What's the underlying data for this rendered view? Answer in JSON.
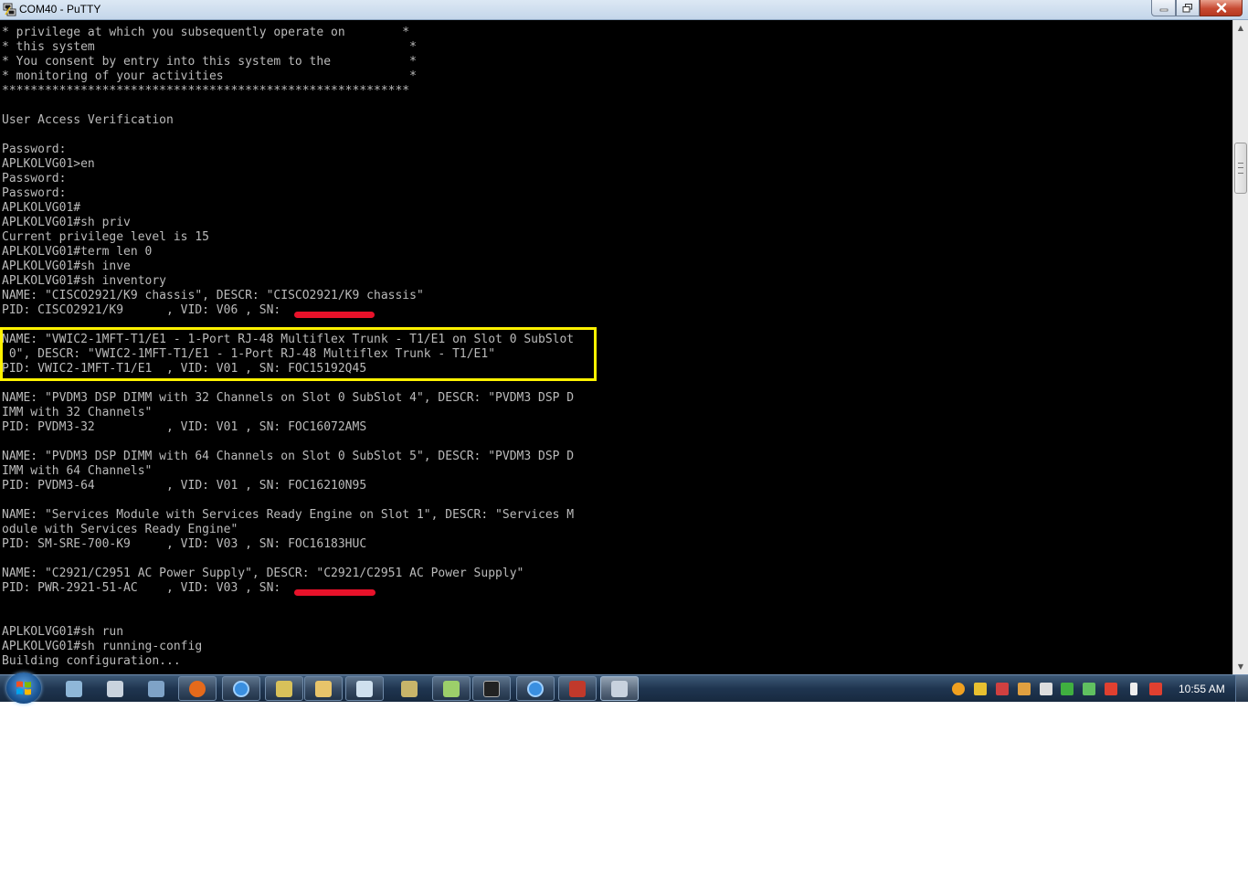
{
  "window": {
    "title": "COM40 - PuTTY"
  },
  "terminal": {
    "lines": [
      "* privilege at which you subsequently operate on        *",
      "* this system                                            *",
      "* You consent by entry into this system to the           *",
      "* monitoring of your activities                          *",
      "*********************************************************",
      "",
      "User Access Verification",
      "",
      "Password:",
      "APLKOLVG01>en",
      "Password:",
      "Password:",
      "APLKOLVG01#",
      "APLKOLVG01#sh priv",
      "Current privilege level is 15",
      "APLKOLVG01#term len 0",
      "APLKOLVG01#sh inve",
      "APLKOLVG01#sh inventory",
      "NAME: \"CISCO2921/K9 chassis\", DESCR: \"CISCO2921/K9 chassis\"",
      "PID: CISCO2921/K9      , VID: V06 , SN: ",
      "",
      "NAME: \"VWIC2-1MFT-T1/E1 - 1-Port RJ-48 Multiflex Trunk - T1/E1 on Slot 0 SubSlot",
      " 0\", DESCR: \"VWIC2-1MFT-T1/E1 - 1-Port RJ-48 Multiflex Trunk - T1/E1\"",
      "PID: VWIC2-1MFT-T1/E1  , VID: V01 , SN: FOC15192Q45",
      "",
      "NAME: \"PVDM3 DSP DIMM with 32 Channels on Slot 0 SubSlot 4\", DESCR: \"PVDM3 DSP D",
      "IMM with 32 Channels\"",
      "PID: PVDM3-32          , VID: V01 , SN: FOC16072AMS",
      "",
      "NAME: \"PVDM3 DSP DIMM with 64 Channels on Slot 0 SubSlot 5\", DESCR: \"PVDM3 DSP D",
      "IMM with 64 Channels\"",
      "PID: PVDM3-64          , VID: V01 , SN: FOC16210N95",
      "",
      "NAME: \"Services Module with Services Ready Engine on Slot 1\", DESCR: \"Services M",
      "odule with Services Ready Engine\"",
      "PID: SM-SRE-700-K9     , VID: V03 , SN: FOC16183HUC",
      "",
      "NAME: \"C2921/C2951 AC Power Supply\", DESCR: \"C2921/C2951 AC Power Supply\"",
      "PID: PWR-2921-51-AC    , VID: V03 , SN: ",
      "",
      "",
      "APLKOLVG01#sh run",
      "APLKOLVG01#sh running-config",
      "Building configuration..."
    ]
  },
  "taskbar": {
    "items": [
      {
        "name": "system-tool-icon",
        "color": "#8fb7d8"
      },
      {
        "name": "calculator-icon",
        "color": "#c9d3de"
      },
      {
        "name": "network-diagram-icon",
        "color": "#7fa3c7"
      },
      {
        "name": "firefox-icon",
        "color": "#e56a1b"
      },
      {
        "name": "internet-explorer-icon",
        "color": "#3a8fe0"
      },
      {
        "name": "paint-icon",
        "color": "#d8c15a"
      },
      {
        "name": "file-explorer-icon",
        "color": "#e8c46a"
      },
      {
        "name": "notepad-icon",
        "color": "#cfe0ee"
      },
      {
        "name": "network-tool-icon",
        "color": "#c8b56a"
      },
      {
        "name": "chat-icon",
        "color": "#9ccf6a"
      },
      {
        "name": "command-prompt-icon",
        "color": "#222222"
      },
      {
        "name": "internet-explorer-icon",
        "color": "#3a8fe0"
      },
      {
        "name": "outlook-icon",
        "color": "#c0392b"
      },
      {
        "name": "putty-icon",
        "color": "#c8d2de"
      }
    ],
    "tray": [
      {
        "name": "security-shield-icon",
        "color": "#f0a020"
      },
      {
        "name": "flag-icon",
        "color": "#e8c030"
      },
      {
        "name": "antivirus-icon",
        "color": "#d04040"
      },
      {
        "name": "network-activity-icon",
        "color": "#e0a040"
      },
      {
        "name": "lock-icon",
        "color": "#dddddd"
      },
      {
        "name": "monitor-icon",
        "color": "#40b040"
      },
      {
        "name": "network-status-icon",
        "color": "#60c060"
      },
      {
        "name": "volume-icon",
        "color": "#e04030"
      },
      {
        "name": "battery-icon",
        "color": "#eeeeee"
      },
      {
        "name": "volume-muted-icon",
        "color": "#e04030"
      }
    ],
    "clock": "10:55 AM"
  },
  "colors": {
    "terminal_background": "#000000",
    "terminal_text": "#bbbbbb",
    "highlight_border": "#fff200",
    "redaction": "#e8122a"
  }
}
